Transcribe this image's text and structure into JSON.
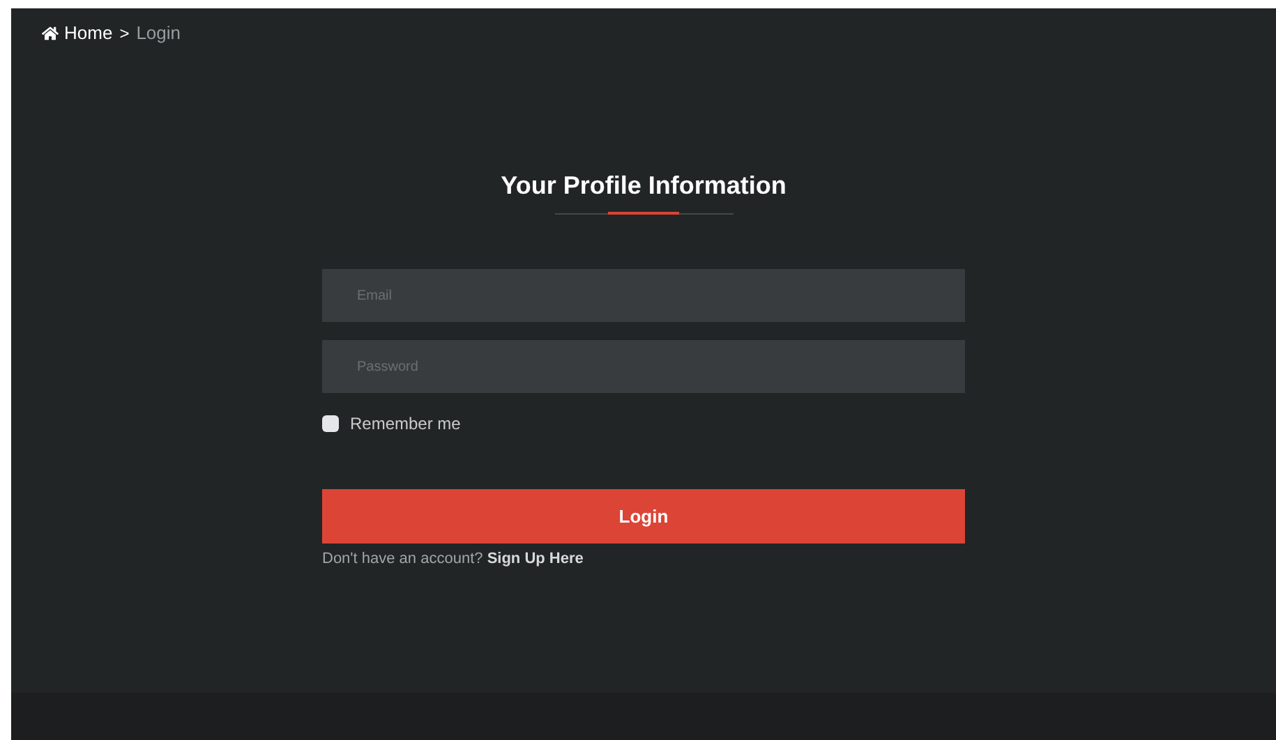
{
  "breadcrumb": {
    "items": [
      {
        "label": "Home",
        "current": false
      },
      {
        "label": "Login",
        "current": true
      }
    ],
    "separator": ">"
  },
  "title": "Your Profile Information",
  "fields": [
    {
      "placeholder": "Email"
    },
    {
      "placeholder": "Password"
    }
  ],
  "remember": {
    "label": "Remember me",
    "checked": false
  },
  "submit": "Login",
  "signup": {
    "text": "Don't have an account?",
    "link": "Sign Up Here"
  }
}
